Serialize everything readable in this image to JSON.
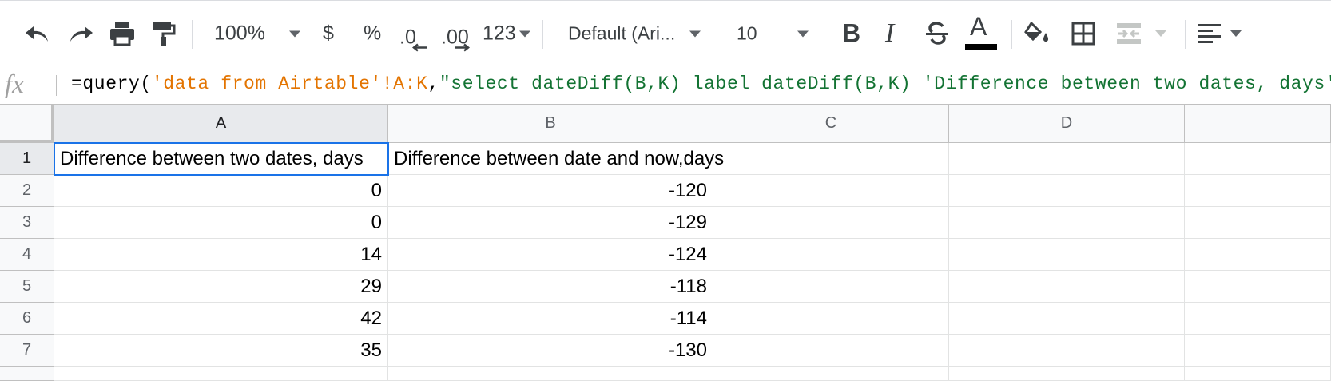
{
  "toolbar": {
    "zoom": "100%",
    "currency": "$",
    "percent": "%",
    "decrease_decimals": ".0",
    "increase_decimals": ".00",
    "number_format": "123",
    "font_family": "Default (Ari...",
    "font_size": "10",
    "text_color_letter": "A",
    "text_color_swatch": "#000000"
  },
  "formula_bar": {
    "fx_label": "fx",
    "formula_prefix": "=query(",
    "formula_range": "'data from Airtable'!A:K",
    "formula_comma": ",",
    "formula_string": "\"select dateDiff(B,K) label dateDiff(B,K) 'Difference between two dates, days'\"",
    "formula_suffix": ")"
  },
  "sheet": {
    "columns": [
      "A",
      "B",
      "C",
      "D"
    ],
    "rows": [
      {
        "num": "1",
        "a": "Difference between two dates, days",
        "b": "Difference between date and now,days"
      },
      {
        "num": "2",
        "a": "0",
        "b": "-120"
      },
      {
        "num": "3",
        "a": "0",
        "b": "-129"
      },
      {
        "num": "4",
        "a": "14",
        "b": "-124"
      },
      {
        "num": "5",
        "a": "29",
        "b": "-118"
      },
      {
        "num": "6",
        "a": "42",
        "b": "-114"
      },
      {
        "num": "7",
        "a": "35",
        "b": "-130"
      }
    ],
    "selected_cell": "A1",
    "selection_color": "#1a73e8"
  }
}
